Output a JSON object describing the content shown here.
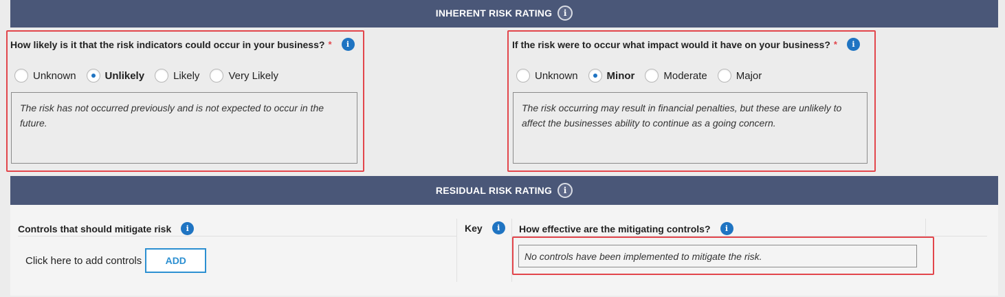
{
  "inherent": {
    "title": "INHERENT RISK RATING",
    "info_glyph": "i",
    "likelihood": {
      "question": "How likely is it that the risk indicators could occur in your business?",
      "required": "*",
      "options": [
        "Unknown",
        "Unlikely",
        "Likely",
        "Very Likely"
      ],
      "selected": "Unlikely",
      "description": "The risk has not occurred previously and is not expected to occur in the future."
    },
    "impact": {
      "question": "If the risk were to occur what impact would it have on your business?",
      "required": "*",
      "options": [
        "Unknown",
        "Minor",
        "Moderate",
        "Major"
      ],
      "selected": "Minor",
      "description": "The risk occurring may result in financial penalties, but these are unlikely to affect the businesses ability to continue as a going concern."
    }
  },
  "residual": {
    "title": "RESIDUAL RISK RATING",
    "controls_heading": "Controls that should mitigate risk",
    "key_heading": "Key",
    "effectiveness_heading": "How effective are the mitigating controls?",
    "add_prompt": "Click here to add controls",
    "add_button": "ADD",
    "mitigation_text": "No controls have been implemented to mitigate the risk."
  },
  "colors": {
    "header_band": "#4a5778",
    "accent_blue": "#1f74c2",
    "highlight_red": "#e2454b"
  },
  "icons": [
    "info-icon",
    "radio-button"
  ]
}
